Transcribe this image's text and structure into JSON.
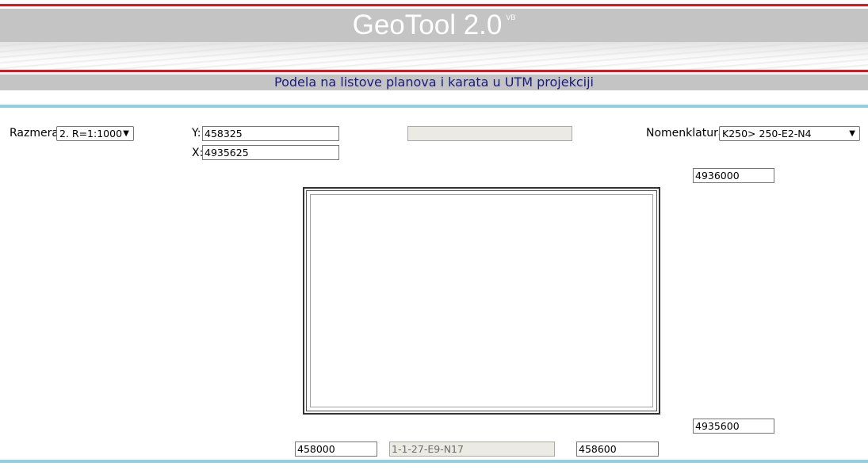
{
  "header": {
    "title": "GeoTool 2.0",
    "title_sup": "VB",
    "subtitle": "Podela na listove planova i karata u UTM projekciji"
  },
  "controls": {
    "razmera_label": "Razmera:",
    "razmera_value": "2. R=1:1000",
    "y_label": "Y:",
    "y_value": "458325",
    "x_label": "X:",
    "x_value": "4935625",
    "readonly_top_value": "",
    "nomenklatura_label": "Nomenklatura:",
    "nomenklatura_value": "K250> 250-E2-N4"
  },
  "sheet": {
    "top_right_x": "4936000",
    "bottom_right_x": "4935600",
    "bottom_left_y": "458000",
    "sheet_name": "1-1-27-E9-N17",
    "bottom_right_y": "458600",
    "textarea_content": ""
  },
  "icons": {
    "dropdown": "chevron-down-icon",
    "resize": "resize-grip-icon"
  },
  "colors": {
    "accent_red": "#e0161c",
    "header_gray": "#c4c4c4",
    "teal_rule": "#93cfdc",
    "subtitle_text": "#1a1a80"
  }
}
